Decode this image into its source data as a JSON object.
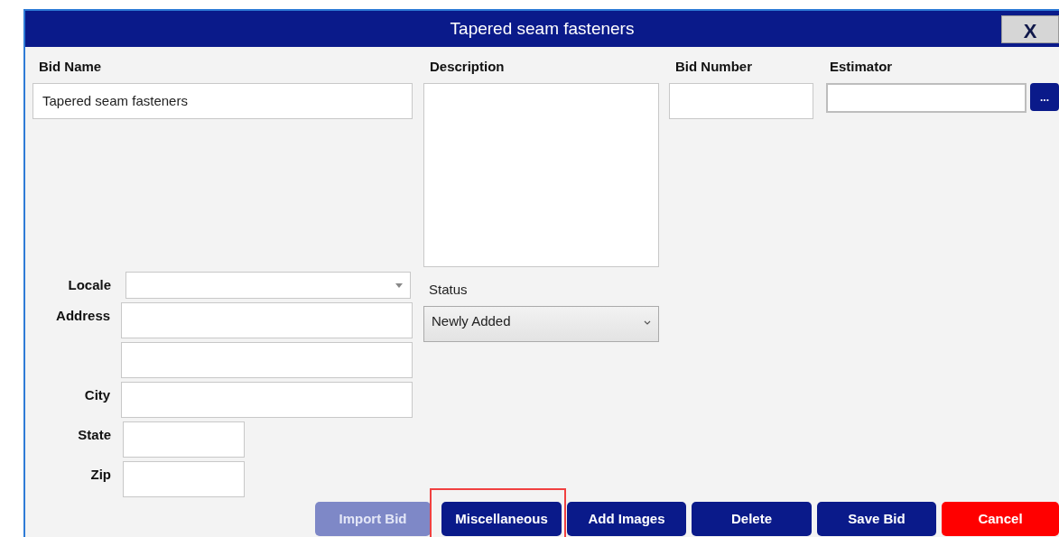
{
  "window": {
    "title": "Tapered seam fasteners",
    "close": "X"
  },
  "bid_name": {
    "label": "Bid Name",
    "value": "Tapered seam fasteners"
  },
  "description": {
    "label": "Description"
  },
  "bid_number": {
    "label": "Bid Number"
  },
  "estimator": {
    "label": "Estimator",
    "browse": "..."
  },
  "locale": {
    "label": "Locale"
  },
  "address": {
    "label": "Address"
  },
  "city": {
    "label": "City"
  },
  "state": {
    "label": "State"
  },
  "zip": {
    "label": "Zip"
  },
  "status": {
    "label": "Status",
    "value": "Newly Added"
  },
  "buttons": [
    {
      "label": "Import Bid",
      "kind": "normal",
      "disabled": true,
      "highlighted": false
    },
    {
      "label": "Miscellaneous",
      "kind": "normal",
      "disabled": false,
      "highlighted": true
    },
    {
      "label": "Add Images",
      "kind": "normal",
      "disabled": false,
      "highlighted": false
    },
    {
      "label": "Delete",
      "kind": "normal",
      "disabled": false,
      "highlighted": false
    },
    {
      "label": "Save Bid",
      "kind": "normal",
      "disabled": false,
      "highlighted": false
    },
    {
      "label": "Cancel",
      "kind": "danger",
      "disabled": false,
      "highlighted": false
    }
  ]
}
